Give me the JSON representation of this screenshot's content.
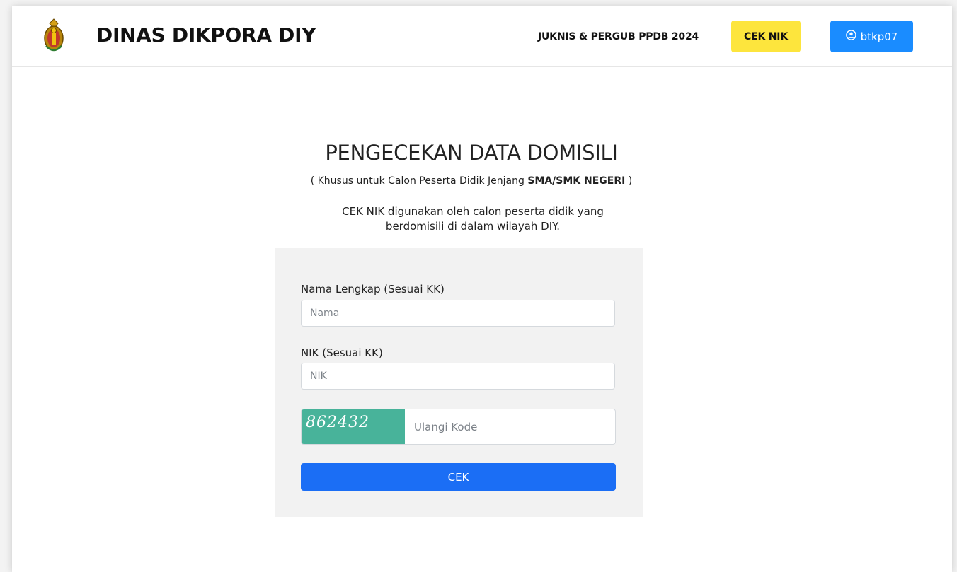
{
  "header": {
    "brand": "DINAS DIKPORA DIY",
    "nav_link": "JUKNIS & PERGUB PPDB 2024",
    "cek_nik_button": "CEK NIK",
    "user_button": "btkp07",
    "user_icon": "user-circle-icon",
    "logo_icon": "emblem-logo-icon"
  },
  "main": {
    "title": "PENGECEKAN DATA DOMISILI",
    "subtitle_prefix": "( Khusus untuk Calon Peserta Didik Jenjang ",
    "subtitle_bold": "SMA/SMK NEGERI",
    "subtitle_suffix": " )",
    "description": "CEK NIK digunakan oleh calon peserta didik yang berdomisili di dalam wilayah DIY."
  },
  "form": {
    "name_label": "Nama Lengkap (Sesuai KK)",
    "name_placeholder": "Nama",
    "nik_label": "NIK (Sesuai KK)",
    "nik_placeholder": "NIK",
    "captcha_code": "862432",
    "captcha_placeholder": "Ulangi Kode",
    "submit_label": "CEK"
  },
  "colors": {
    "cek_nik_bg": "#fde53d",
    "user_button_bg": "#1a8cff",
    "submit_bg": "#1b6ef5",
    "captcha_bg": "#48b39a",
    "card_bg": "#f2f2f2"
  }
}
